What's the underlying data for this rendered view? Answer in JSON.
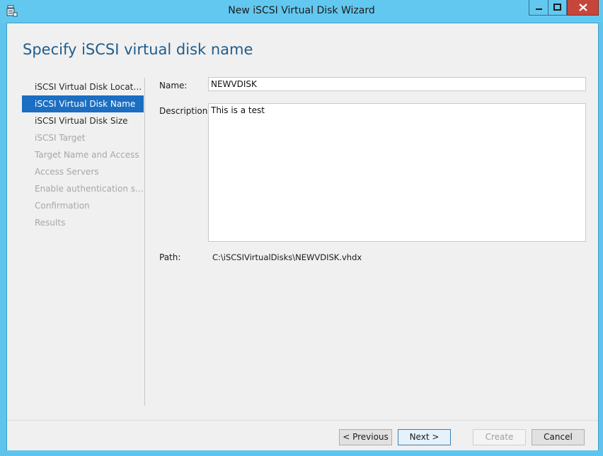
{
  "window": {
    "title": "New iSCSI Virtual Disk Wizard",
    "icons": [
      "app-icon",
      "minimize-icon",
      "maximize-icon",
      "close-icon"
    ]
  },
  "page": {
    "heading": "Specify iSCSI virtual disk name"
  },
  "steps": [
    {
      "label": "iSCSI Virtual Disk Location",
      "state": "done"
    },
    {
      "label": "iSCSI Virtual Disk Name",
      "state": "active"
    },
    {
      "label": "iSCSI Virtual Disk Size",
      "state": "done"
    },
    {
      "label": "iSCSI Target",
      "state": "disabled"
    },
    {
      "label": "Target Name and Access",
      "state": "disabled"
    },
    {
      "label": "Access Servers",
      "state": "disabled"
    },
    {
      "label": "Enable authentication ser...",
      "state": "disabled"
    },
    {
      "label": "Confirmation",
      "state": "disabled"
    },
    {
      "label": "Results",
      "state": "disabled"
    }
  ],
  "form": {
    "name_label": "Name:",
    "name_value": "NEWVDISK",
    "description_label": "Description:",
    "description_value": "This is a test",
    "path_label": "Path:",
    "path_value": "C:\\iSCSIVirtualDisks\\NEWVDISK.vhdx"
  },
  "buttons": {
    "previous": "< Previous",
    "next": "Next >",
    "create": "Create",
    "cancel": "Cancel"
  },
  "colors": {
    "title_bar": "#63c8ef",
    "accent_selected": "#1b6ec2",
    "heading": "#1f5d8c",
    "close_button": "#c7463c"
  }
}
